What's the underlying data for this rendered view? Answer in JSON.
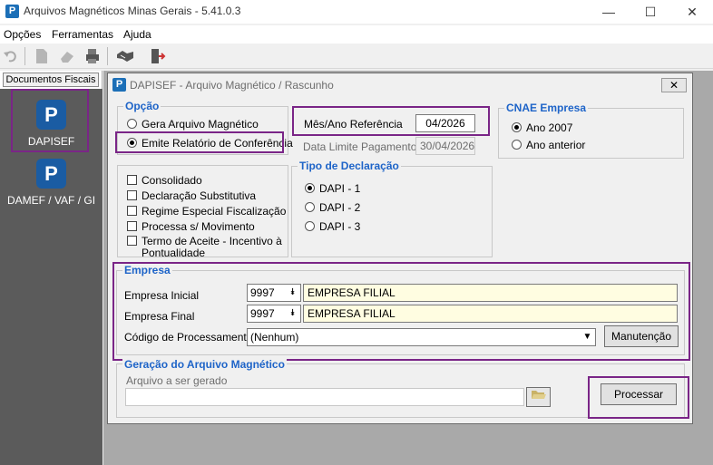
{
  "window": {
    "title": "Arquivos Magnéticos Minas Gerais - 5.41.0.3",
    "minimize": "—",
    "maximize": "☐",
    "close": "✕",
    "icon_letter": "P"
  },
  "menu": {
    "items": [
      "Opções",
      "Ferramentas",
      "Ajuda"
    ]
  },
  "sidebar": {
    "tab_label": "Documentos Fiscais",
    "items": [
      {
        "label": "DAPISEF",
        "icon": "dapisef-logo-icon",
        "icon_letter": "P"
      },
      {
        "label": "DAMEF / VAF / GI",
        "icon": "damef-logo-icon",
        "icon_letter": "P"
      }
    ]
  },
  "child": {
    "title": "DAPISEF - Arquivo Magnético / Rascunho",
    "close": "✕",
    "icon_letter": "P",
    "opcao": {
      "title": "Opção",
      "options": [
        "Gera Arquivo Magnético",
        "Emite Relatório de Conferência"
      ],
      "selected": "Emite Relatório de Conferência"
    },
    "referencia": {
      "mes_ano_label": "Mês/Ano Referência",
      "mes_ano_value": "04/2026",
      "data_limite_label": "Data Limite Pagamento",
      "data_limite_value": "30/04/2026"
    },
    "cnae": {
      "title": "CNAE Empresa",
      "options": [
        "Ano 2007",
        "Ano anterior"
      ],
      "selected": "Ano 2007"
    },
    "checks": {
      "items": [
        "Consolidado",
        "Declaração Substitutiva",
        "Regime Especial Fiscalização",
        "Processa s/ Movimento",
        "Termo de Aceite - Incentivo à",
        "Pontualidade"
      ]
    },
    "tipo": {
      "title": "Tipo de Declaração",
      "options": [
        "DAPI - 1",
        "DAPI - 2",
        "DAPI - 3"
      ],
      "selected": "DAPI - 1"
    },
    "empresa": {
      "title": "Empresa",
      "inicial_label": "Empresa Inicial",
      "inicial_code": "9997",
      "inicial_name": "EMPRESA FILIAL",
      "final_label": "Empresa Final",
      "final_code": "9997",
      "final_name": "EMPRESA FILIAL",
      "codigo_label": "Código de Processamento",
      "codigo_value": "(Nenhum)",
      "manutencao_label": "Manutenção"
    },
    "geracao": {
      "title": "Geração do Arquivo Magnético",
      "arquivo_label": "Arquivo a ser gerado",
      "arquivo_value": "",
      "processar_label": "Processar"
    }
  }
}
